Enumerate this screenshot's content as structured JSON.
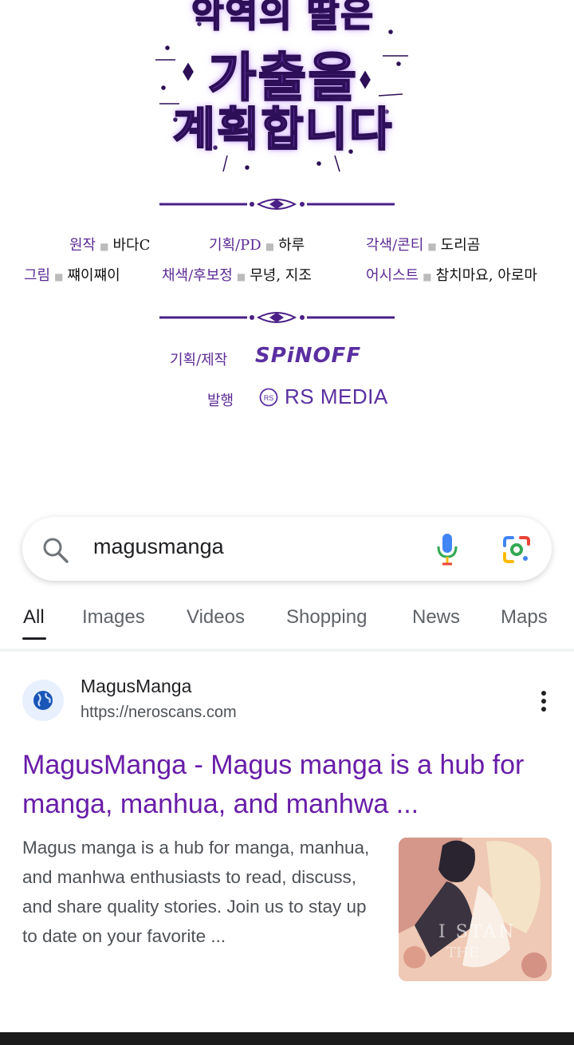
{
  "comic": {
    "title_lines": [
      "악역의 딸은",
      "가출을",
      "계획합니다"
    ],
    "credits_row1": [
      {
        "role": "원작",
        "name": "바다C"
      },
      {
        "role": "기획/PD",
        "name": "하루"
      },
      {
        "role": "각색/콘티",
        "name": "도리곰"
      }
    ],
    "credits_row2": [
      {
        "role": "그림",
        "name": "쨰이쨰이"
      },
      {
        "role": "채색/후보정",
        "name": "무녕, 지조"
      },
      {
        "role": "어시스트",
        "name": "참치마요, 아로마"
      }
    ],
    "production_label": "기획/제작",
    "production_brand": "SPiNOFF",
    "publisher_label": "발행",
    "publisher_brand": "RS MEDIA",
    "accent_color": "#5a2fa0"
  },
  "search": {
    "query": "magusmanga",
    "icons": [
      "search-icon",
      "mic-icon",
      "lens-icon"
    ]
  },
  "tabs": [
    {
      "label": "All",
      "active": true
    },
    {
      "label": "Images",
      "active": false
    },
    {
      "label": "Videos",
      "active": false
    },
    {
      "label": "Shopping",
      "active": false
    },
    {
      "label": "News",
      "active": false
    },
    {
      "label": "Maps",
      "active": false
    }
  ],
  "result": {
    "site_name": "MagusManga",
    "url": "https://neroscans.com",
    "title": "MagusManga - Magus manga is a hub for manga, manhua, and manhwa ...",
    "snippet": "Magus manga is a hub for manga, manhua, and manhwa enthusiasts to read, discuss, and share quality stories. Join us to stay up to date on your favorite ...",
    "title_color": "#681da8",
    "favicon": "globe-icon",
    "menu_icon": "more-vert-icon"
  }
}
